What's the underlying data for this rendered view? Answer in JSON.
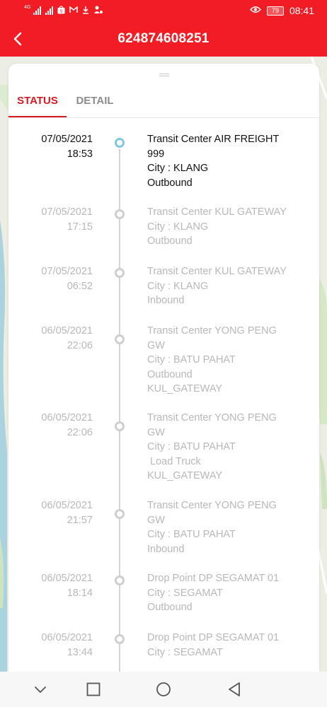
{
  "status_bar": {
    "network_tag": "4G",
    "battery": "79",
    "time": "08:41"
  },
  "header": {
    "title": "624874608251"
  },
  "tabs": [
    {
      "label": "STATUS",
      "active": true
    },
    {
      "label": "DETAIL",
      "active": false
    }
  ],
  "colors": {
    "brand_red": "#f11c24",
    "tab_active": "#d71920",
    "active_dot": "#7fc8dd",
    "muted_text": "#b8b8b8"
  },
  "events": [
    {
      "date": "07/05/2021",
      "time": "18:53",
      "lines": [
        "Transit Center AIR FREIGHT",
        "999",
        "City : KLANG",
        "Outbound"
      ],
      "active": true
    },
    {
      "date": "07/05/2021",
      "time": "17:15",
      "lines": [
        "Transit Center KUL GATEWAY",
        "City : KLANG",
        "Outbound"
      ],
      "active": false
    },
    {
      "date": "07/05/2021",
      "time": "06:52",
      "lines": [
        "Transit Center KUL GATEWAY",
        "City : KLANG",
        "Inbound"
      ],
      "active": false
    },
    {
      "date": "06/05/2021",
      "time": "22:06",
      "lines": [
        "Transit Center YONG PENG",
        "GW",
        "City : BATU PAHAT",
        "Outbound",
        "KUL_GATEWAY"
      ],
      "active": false
    },
    {
      "date": "06/05/2021",
      "time": "22:06",
      "lines": [
        "Transit Center YONG PENG",
        "GW",
        "City : BATU PAHAT",
        " Load Truck",
        "KUL_GATEWAY"
      ],
      "active": false
    },
    {
      "date": "06/05/2021",
      "time": "21:57",
      "lines": [
        "Transit Center YONG PENG",
        "GW",
        "City : BATU PAHAT",
        "Inbound"
      ],
      "active": false
    },
    {
      "date": "06/05/2021",
      "time": "18:14",
      "lines": [
        "Drop Point DP SEGAMAT 01",
        "City : SEGAMAT",
        "Outbound"
      ],
      "active": false
    },
    {
      "date": "06/05/2021",
      "time": "13:44",
      "lines": [
        "Drop Point DP SEGAMAT 01",
        "City : SEGAMAT"
      ],
      "active": false
    }
  ]
}
